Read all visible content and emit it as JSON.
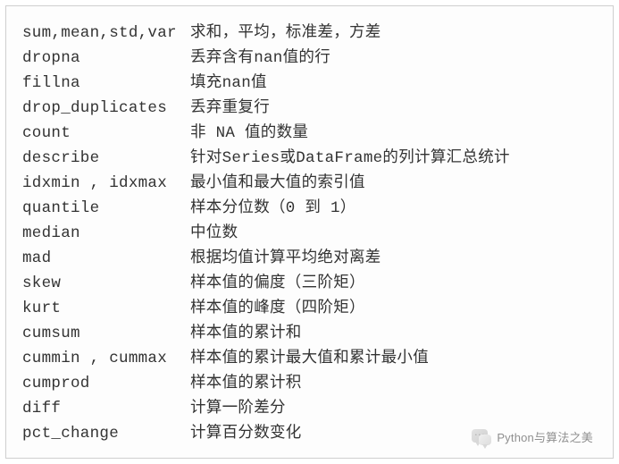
{
  "rows": [
    {
      "fn": "sum,mean,std,var",
      "desc": "求和，平均，标准差，方差"
    },
    {
      "fn": "dropna",
      "desc": "丢弃含有nan值的行"
    },
    {
      "fn": "fillna",
      "desc": "填充nan值"
    },
    {
      "fn": "drop_duplicates",
      "desc": "丢弃重复行"
    },
    {
      "fn": "count",
      "desc": "非 NA 值的数量"
    },
    {
      "fn": "describe",
      "desc": "针对Series或DataFrame的列计算汇总统计"
    },
    {
      "fn": "idxmin , idxmax",
      "desc": "最小值和最大值的索引值"
    },
    {
      "fn": "quantile",
      "desc": "样本分位数（0 到 1）"
    },
    {
      "fn": "median",
      "desc": "中位数"
    },
    {
      "fn": "mad",
      "desc": "根据均值计算平均绝对离差"
    },
    {
      "fn": "skew",
      "desc": "样本值的偏度（三阶矩）"
    },
    {
      "fn": "kurt",
      "desc": "样本值的峰度（四阶矩）"
    },
    {
      "fn": "cumsum",
      "desc": "样本值的累计和"
    },
    {
      "fn": "cummin , cummax",
      "desc": "样本值的累计最大值和累计最小值"
    },
    {
      "fn": "cumprod",
      "desc": "样本值的累计积"
    },
    {
      "fn": "diff",
      "desc": "计算一阶差分"
    },
    {
      "fn": "pct_change",
      "desc": "计算百分数变化"
    }
  ],
  "watermark": {
    "label": "Python与算法之美"
  }
}
